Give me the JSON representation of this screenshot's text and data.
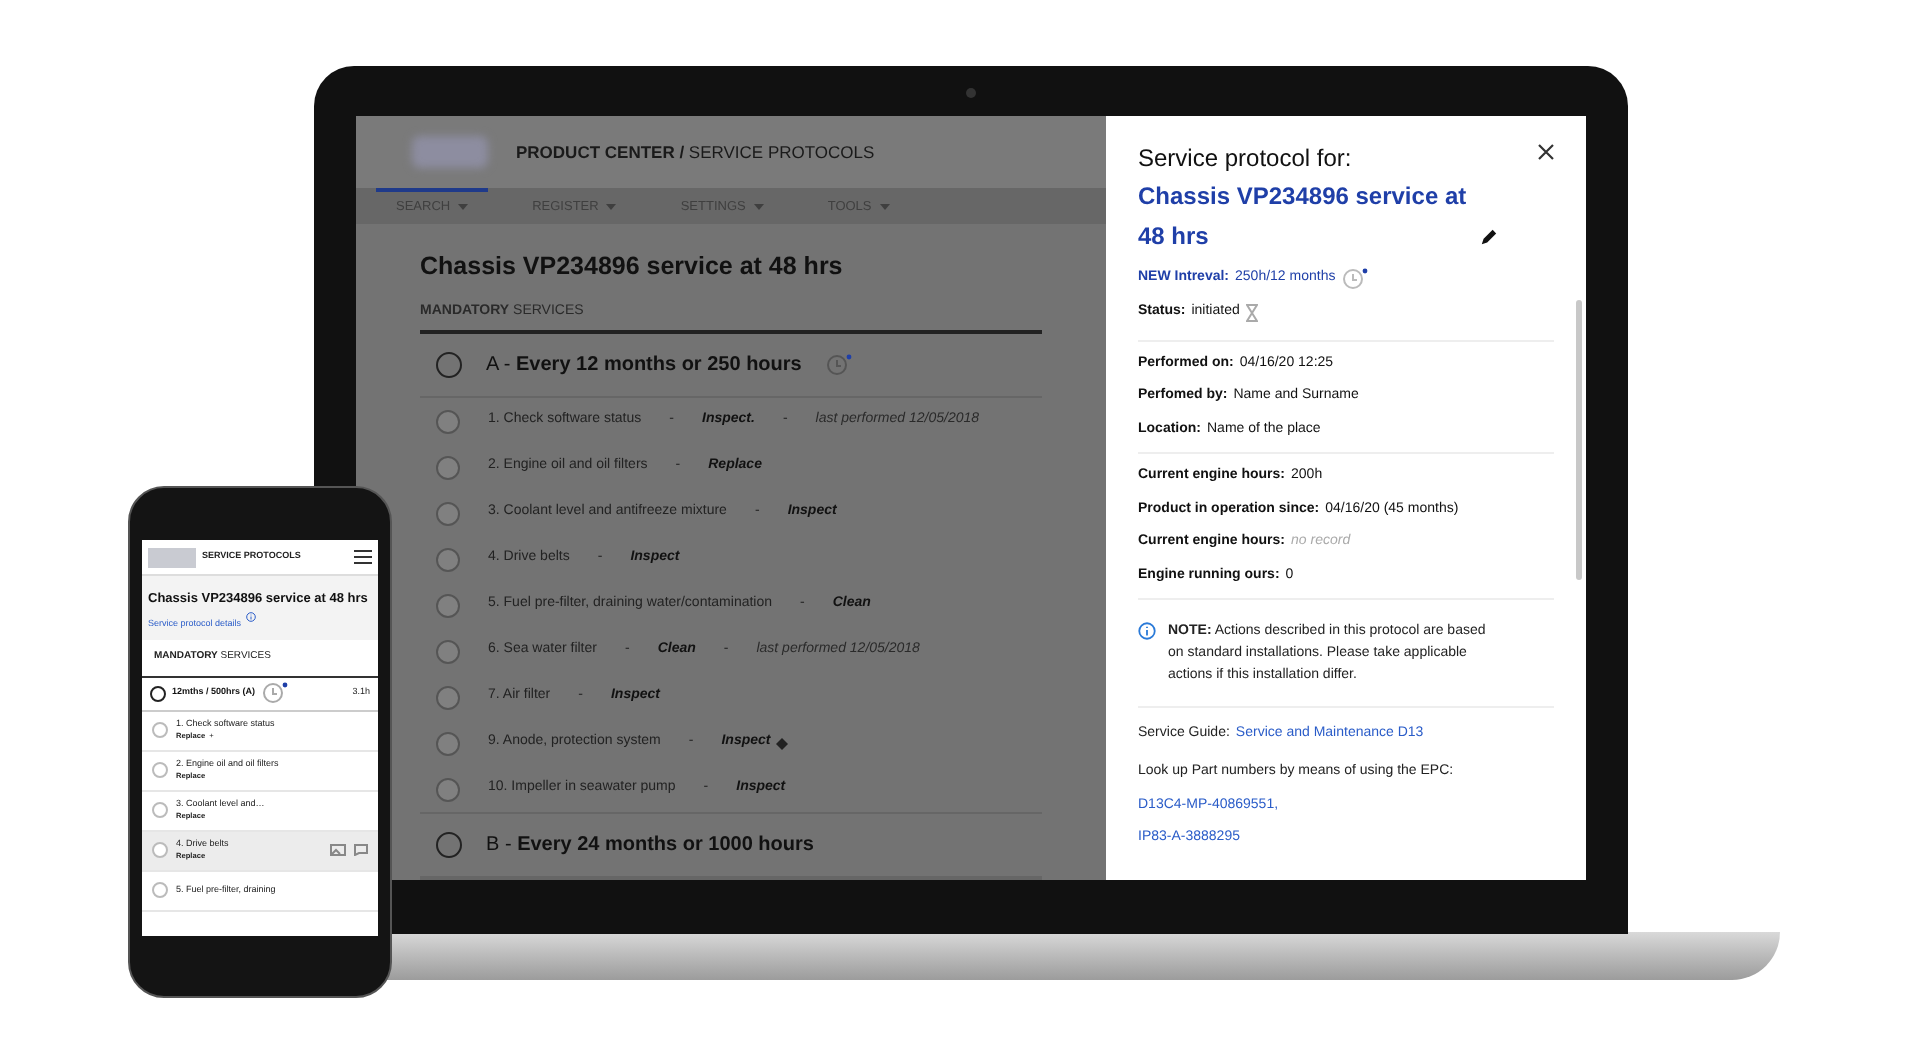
{
  "laptop": {
    "breadcrumb": "**PRODUCT CENTER /** SERVICE PROTOCOLS",
    "nav": [
      {
        "label": "SEARCH",
        "selected": true
      },
      {
        "label": "REGISTER",
        "selected": false
      },
      {
        "label": "SETTINGS",
        "selected": false
      },
      {
        "label": "TOOLS",
        "selected": false
      }
    ],
    "page_title": "Chassis VP234896 service at 48 hrs",
    "section": "**MANDATORY** SERVICES",
    "separator": "-",
    "groups": [
      {
        "title": "A - **Every 12 months  or 250 hours**",
        "expanded": true,
        "checked": false,
        "items": [
          {
            "text": "1. Check software status",
            "action": "Inspect.",
            "note": "last performed 12/05/2018",
            "flagged": false,
            "checked": false
          },
          {
            "text": "2. Engine oil and oil filters",
            "action": "Replace",
            "flagged": false,
            "checked": false
          },
          {
            "text": "3. Coolant level and antifreeze mixture",
            "action": "Inspect",
            "flagged": false,
            "checked": false
          },
          {
            "text": "4. Drive belts",
            "action": "Inspect",
            "flagged": false,
            "checked": false
          },
          {
            "text": "5. Fuel pre-filter, draining water/contamination",
            "action": "Clean",
            "flagged": false,
            "checked": false
          },
          {
            "text": "6. Sea water filter",
            "action": "Clean",
            "note": "last performed 12/05/2018",
            "flagged": false,
            "checked": false
          },
          {
            "text": "7. Air filter",
            "action": "Inspect",
            "flagged": false,
            "checked": false
          },
          {
            "text": "9. Anode, protection system",
            "action": "Inspect",
            "flagged": true,
            "checked": false
          },
          {
            "text": "10. Impeller in seawater pump",
            "action": "Inspect",
            "flagged": false,
            "checked": false
          }
        ]
      },
      {
        "title": "B - **Every 24 months or 1000 hours**",
        "expanded": false,
        "checked": false
      }
    ]
  },
  "panel": {
    "heading": "Service protocol for:",
    "title": "Chassis VP234896 service at 48 hrs",
    "interval_label": "NEW Intreval:",
    "interval_value": "250h/12 months",
    "status_label": "Status:",
    "status_value": "initiated",
    "field_groups": [
      [
        {
          "label": "Performed on:",
          "value": "04/16/20 12:25",
          "missing": false
        },
        {
          "label": "Perfomed by:",
          "value": "Name and Surname",
          "missing": false
        },
        {
          "label": "Location:",
          "value": "Name of the place",
          "missing": false
        }
      ],
      [
        {
          "label": "Current engine hours:",
          "value": "200h",
          "missing": false
        },
        {
          "label": "Product in operation since:",
          "value": "04/16/20 (45 months)",
          "missing": false
        },
        {
          "label": "Current engine hours:",
          "value": "no record",
          "missing": true
        },
        {
          "label": "Engine running ours:",
          "value": "0",
          "missing": false
        }
      ]
    ],
    "note": "**NOTE:** Actions described in this protocol are based on standard installations. Please take applicable actions if this installation differ.",
    "guide_label": "Service Guide:",
    "guide_link": "Service and Maintenance D13",
    "lookup": "Look up Part numbers by means of using the EPC:",
    "part_links": [
      "D13C4-MP-40869551,",
      "IP83-A-3888295"
    ]
  },
  "phone": {
    "header": "SERVICE PROTOCOLS",
    "title": "Chassis VP234896 service at 48 hrs",
    "details_link": "Service protocol details",
    "section": "**MANDATORY** SERVICES",
    "group": "12mths / 500hrs (A)",
    "group_checked": false,
    "group_time": "3.1h",
    "items": [
      {
        "text": "1. Check software status",
        "action": "Replace",
        "extra": "+",
        "selected": false,
        "checked": false
      },
      {
        "text": "2. Engine oil and oil filters",
        "action": "Replace",
        "selected": false,
        "checked": false
      },
      {
        "text": "3. Coolant level and…",
        "action": "Replace",
        "selected": false,
        "checked": false
      },
      {
        "text": "4. Drive belts",
        "action": "Replace",
        "selected": true,
        "checked": false
      },
      {
        "text": "5. Fuel pre-filter, draining",
        "selected": false,
        "checked": false
      }
    ]
  }
}
